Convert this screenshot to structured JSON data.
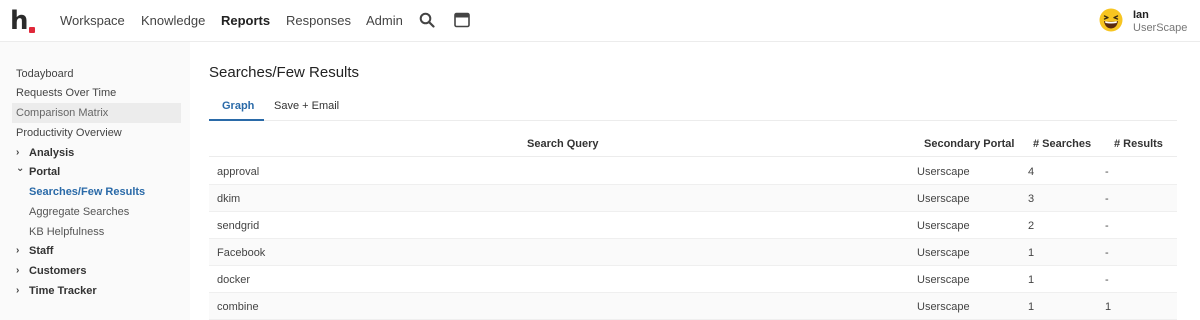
{
  "topnav": {
    "logo_text": "h",
    "items": [
      "Workspace",
      "Knowledge",
      "Reports",
      "Responses",
      "Admin"
    ],
    "active": "Reports",
    "icons": [
      "search-icon",
      "window-icon"
    ]
  },
  "user": {
    "name": "Ian",
    "org": "UserScape",
    "avatar_icon": "laughing-emoji-icon"
  },
  "sidebar": {
    "items": [
      {
        "label": "Todayboard"
      },
      {
        "label": "Requests Over Time"
      },
      {
        "label": "Comparison Matrix"
      },
      {
        "label": "Productivity Overview"
      },
      {
        "label": "Analysis",
        "chevron": "›"
      },
      {
        "label": "Portal",
        "chevron": "⌄"
      },
      {
        "label": "Searches/Few Results"
      },
      {
        "label": "Aggregate Searches"
      },
      {
        "label": "KB Helpfulness"
      },
      {
        "label": "Staff",
        "chevron": "›"
      },
      {
        "label": "Customers",
        "chevron": "›"
      },
      {
        "label": "Time Tracker",
        "chevron": "›"
      }
    ]
  },
  "main": {
    "title": "Searches/Few Results",
    "tabs": [
      {
        "label": "Graph"
      },
      {
        "label": "Save + Email"
      }
    ],
    "active_tab": "Graph",
    "table": {
      "columns": [
        "Search Query",
        "Secondary Portal",
        "# Searches",
        "# Results"
      ],
      "rows": [
        {
          "query": "approval",
          "portal": "Userscape",
          "searches": "4",
          "results": "-"
        },
        {
          "query": "dkim",
          "portal": "Userscape",
          "searches": "3",
          "results": "-"
        },
        {
          "query": "sendgrid",
          "portal": "Userscape",
          "searches": "2",
          "results": "-"
        },
        {
          "query": "Facebook",
          "portal": "Userscape",
          "searches": "1",
          "results": "-"
        },
        {
          "query": "docker",
          "portal": "Userscape",
          "searches": "1",
          "results": "-"
        },
        {
          "query": "combine",
          "portal": "Userscape",
          "searches": "1",
          "results": "1"
        }
      ]
    }
  },
  "colors": {
    "accent": "#2a6aa8",
    "logo_dot": "#e0283a"
  }
}
